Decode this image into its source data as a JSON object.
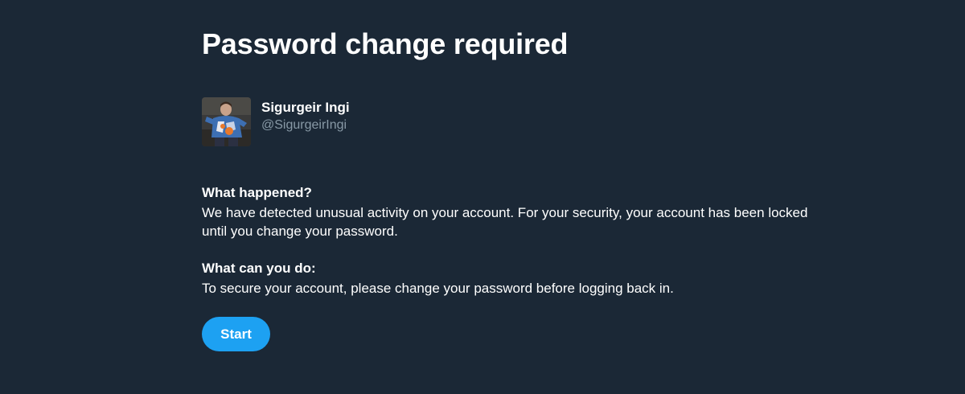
{
  "page": {
    "title": "Password change required"
  },
  "account": {
    "display_name": "Sigurgeir Ingi",
    "handle": "@SigurgeirIngi"
  },
  "sections": [
    {
      "heading": "What happened?",
      "body": "We have detected unusual activity on your account. For your security, your account has been locked until you change your password."
    },
    {
      "heading": "What can you do:",
      "body": "To secure your account, please change your password before logging back in."
    }
  ],
  "actions": {
    "start_label": "Start"
  },
  "colors": {
    "background": "#1b2836",
    "text": "#ffffff",
    "secondary_text": "#8899a6",
    "accent": "#1da1f2"
  }
}
